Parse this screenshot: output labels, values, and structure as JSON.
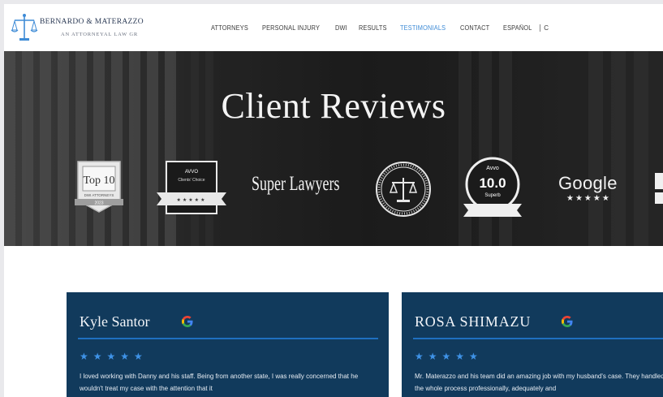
{
  "header": {
    "logo_name": "BERNARDO & MATERAZZO",
    "logo_sub": "AN ATTORNEYAL LAW GR",
    "nav": [
      "ATTORNEYS",
      "PERSONAL INJURY",
      "DWI",
      "RESULTS",
      "TESTIMONIALS",
      "CONTACT",
      "ESPAÑOL"
    ],
    "active_nav": "TESTIMONIALS",
    "phone": "C"
  },
  "hero": {
    "title": "Client Reviews",
    "badges": {
      "top10_line1": "Top 10",
      "top10_line2": "DWI ATTORNEYS",
      "top10_ribbon": "2023",
      "lead_line1": "AVVO",
      "lead_line2": "Clients' Choice",
      "super_lawyers": "Super Lawyers",
      "avvo_label": "Avvo",
      "avvo_rating": "10.0",
      "avvo_sub": "Superb",
      "google": "Google",
      "google_stars": "★★★★★"
    }
  },
  "reviews": [
    {
      "name": "Kyle Santor",
      "stars": "★★★★★",
      "text": "I loved working with Danny and his staff. Being from another state, I was really concerned that he wouldn't treat my case with the attention that it"
    },
    {
      "name": "ROSA SHIMAZU",
      "stars": "★★★★★",
      "text": "Mr. Materazzo and his team did an amazing job with my husband's case. They handled the whole process professionally, adequately and"
    }
  ],
  "colors": {
    "nav_active": "#3e8bd6",
    "card_bg": "#113a5c",
    "star_blue": "#3f93e8",
    "google_red": "#ea4335",
    "google_blue": "#4285f4",
    "google_yellow": "#fbbc05",
    "google_green": "#34a853"
  }
}
